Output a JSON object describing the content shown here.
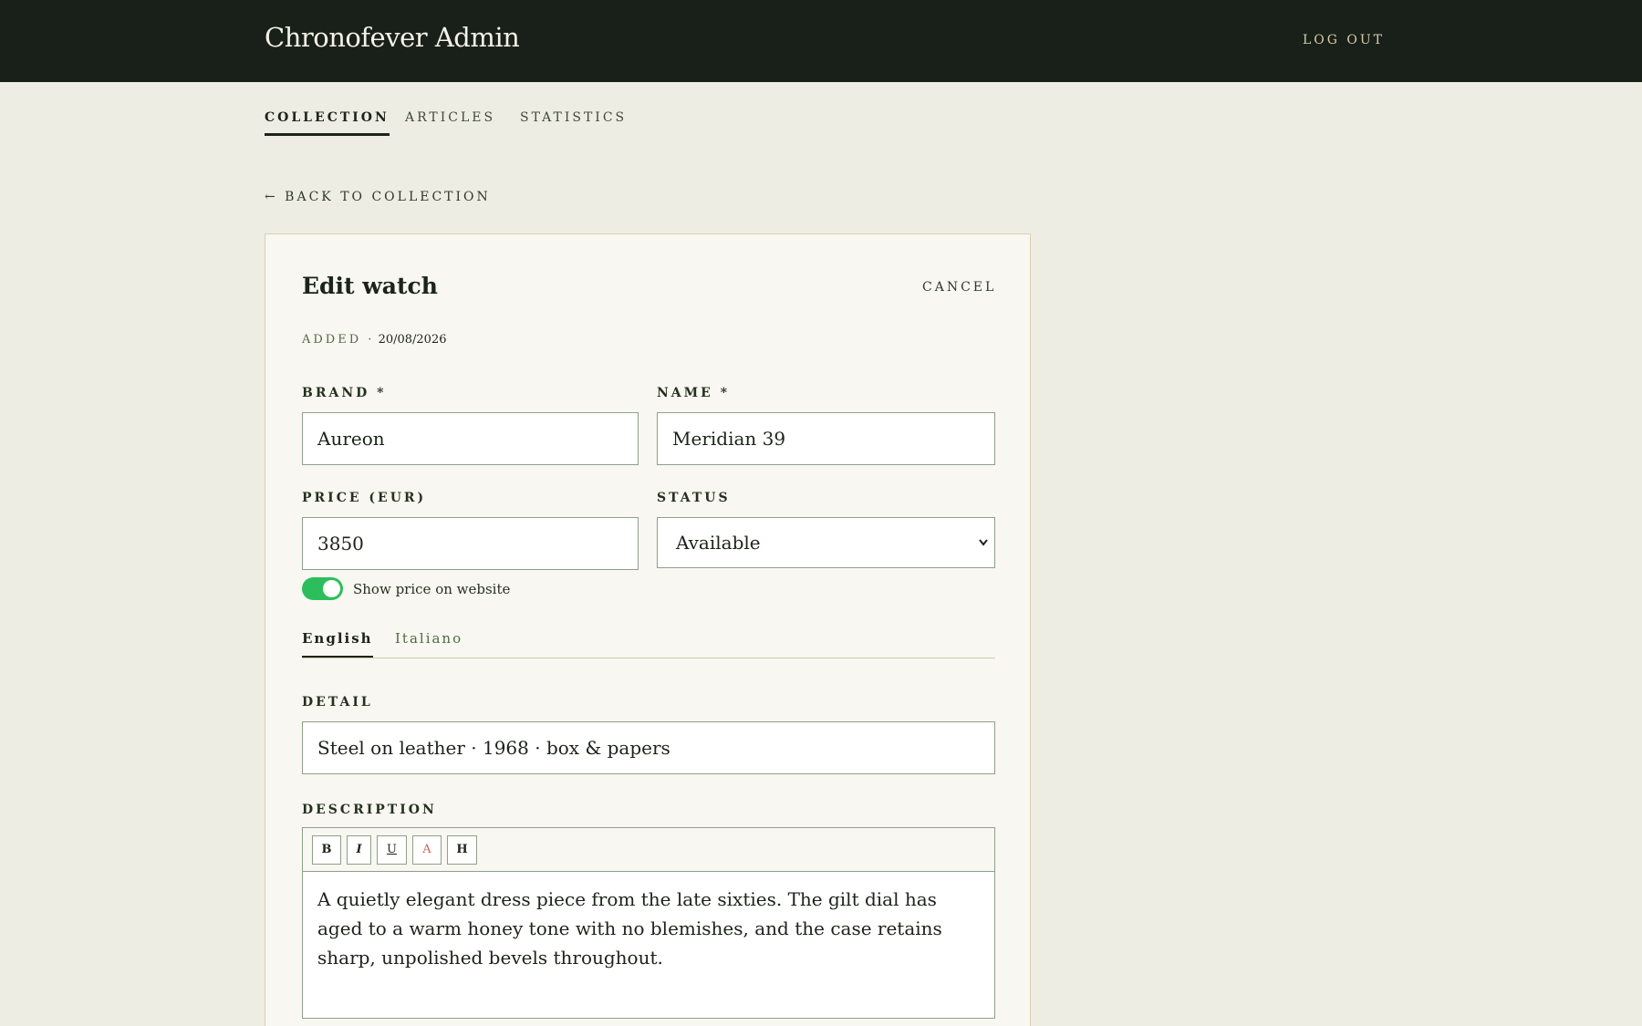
{
  "header": {
    "title": "Chronofever Admin",
    "logout_label": "LOG OUT"
  },
  "nav": {
    "tabs": [
      {
        "label": "COLLECTION",
        "active": true
      },
      {
        "label": "ARTICLES",
        "active": false
      },
      {
        "label": "STATISTICS",
        "active": false
      }
    ]
  },
  "back_link": "← BACK TO COLLECTION",
  "form": {
    "title": "Edit watch",
    "cancel_label": "CANCEL",
    "added_label": "ADDED ·",
    "added_date": "20/08/2026",
    "brand": {
      "label": "BRAND *",
      "value": "Aureon"
    },
    "name": {
      "label": "NAME *",
      "value": "Meridian 39"
    },
    "price": {
      "label": "PRICE (EUR)",
      "value": "3850"
    },
    "status": {
      "label": "STATUS",
      "value": "Available"
    },
    "show_price": {
      "label": "Show price on website",
      "on": true
    },
    "language_tabs": [
      {
        "label": "English",
        "active": true
      },
      {
        "label": "Italiano",
        "active": false
      }
    ],
    "detail": {
      "label": "DETAIL",
      "value": "Steel on leather · 1968 · box & papers"
    },
    "description": {
      "label": "DESCRIPTION",
      "toolbar": [
        "B",
        "I",
        "U",
        "A",
        "H"
      ],
      "text": "A quietly elegant dress piece from the late sixties. The gilt dial has aged to a warm honey tone with no blemishes, and the case retains sharp, unpolished bevels throughout."
    }
  },
  "colors": {
    "header_bg": "#19201a",
    "page_bg": "#eeede4",
    "toggle_on": "#2cbe5c",
    "color_button": "#c0685a"
  }
}
